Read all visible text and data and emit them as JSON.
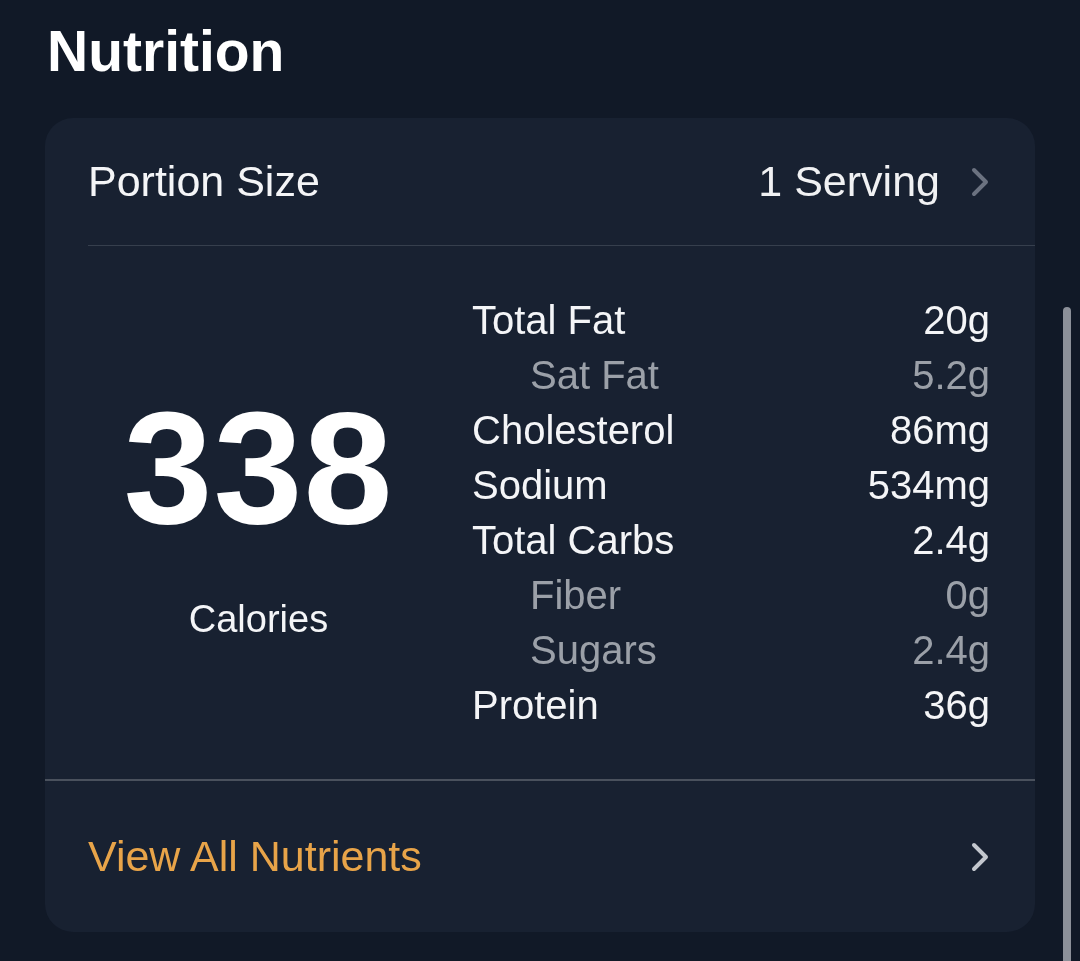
{
  "title": "Nutrition",
  "portion": {
    "label": "Portion Size",
    "value": "1 Serving"
  },
  "calories": {
    "value": "338",
    "label": "Calories"
  },
  "nutrients": [
    {
      "name": "Total Fat",
      "amount": "20g",
      "children": [
        {
          "name": "Sat Fat",
          "amount": "5.2g"
        }
      ]
    },
    {
      "name": "Cholesterol",
      "amount": "86mg"
    },
    {
      "name": "Sodium",
      "amount": "534mg"
    },
    {
      "name": "Total Carbs",
      "amount": "2.4g",
      "children": [
        {
          "name": "Fiber",
          "amount": "0g"
        },
        {
          "name": "Sugars",
          "amount": "2.4g"
        }
      ]
    },
    {
      "name": "Protein",
      "amount": "36g"
    }
  ],
  "link": {
    "label": "View All Nutrients"
  }
}
